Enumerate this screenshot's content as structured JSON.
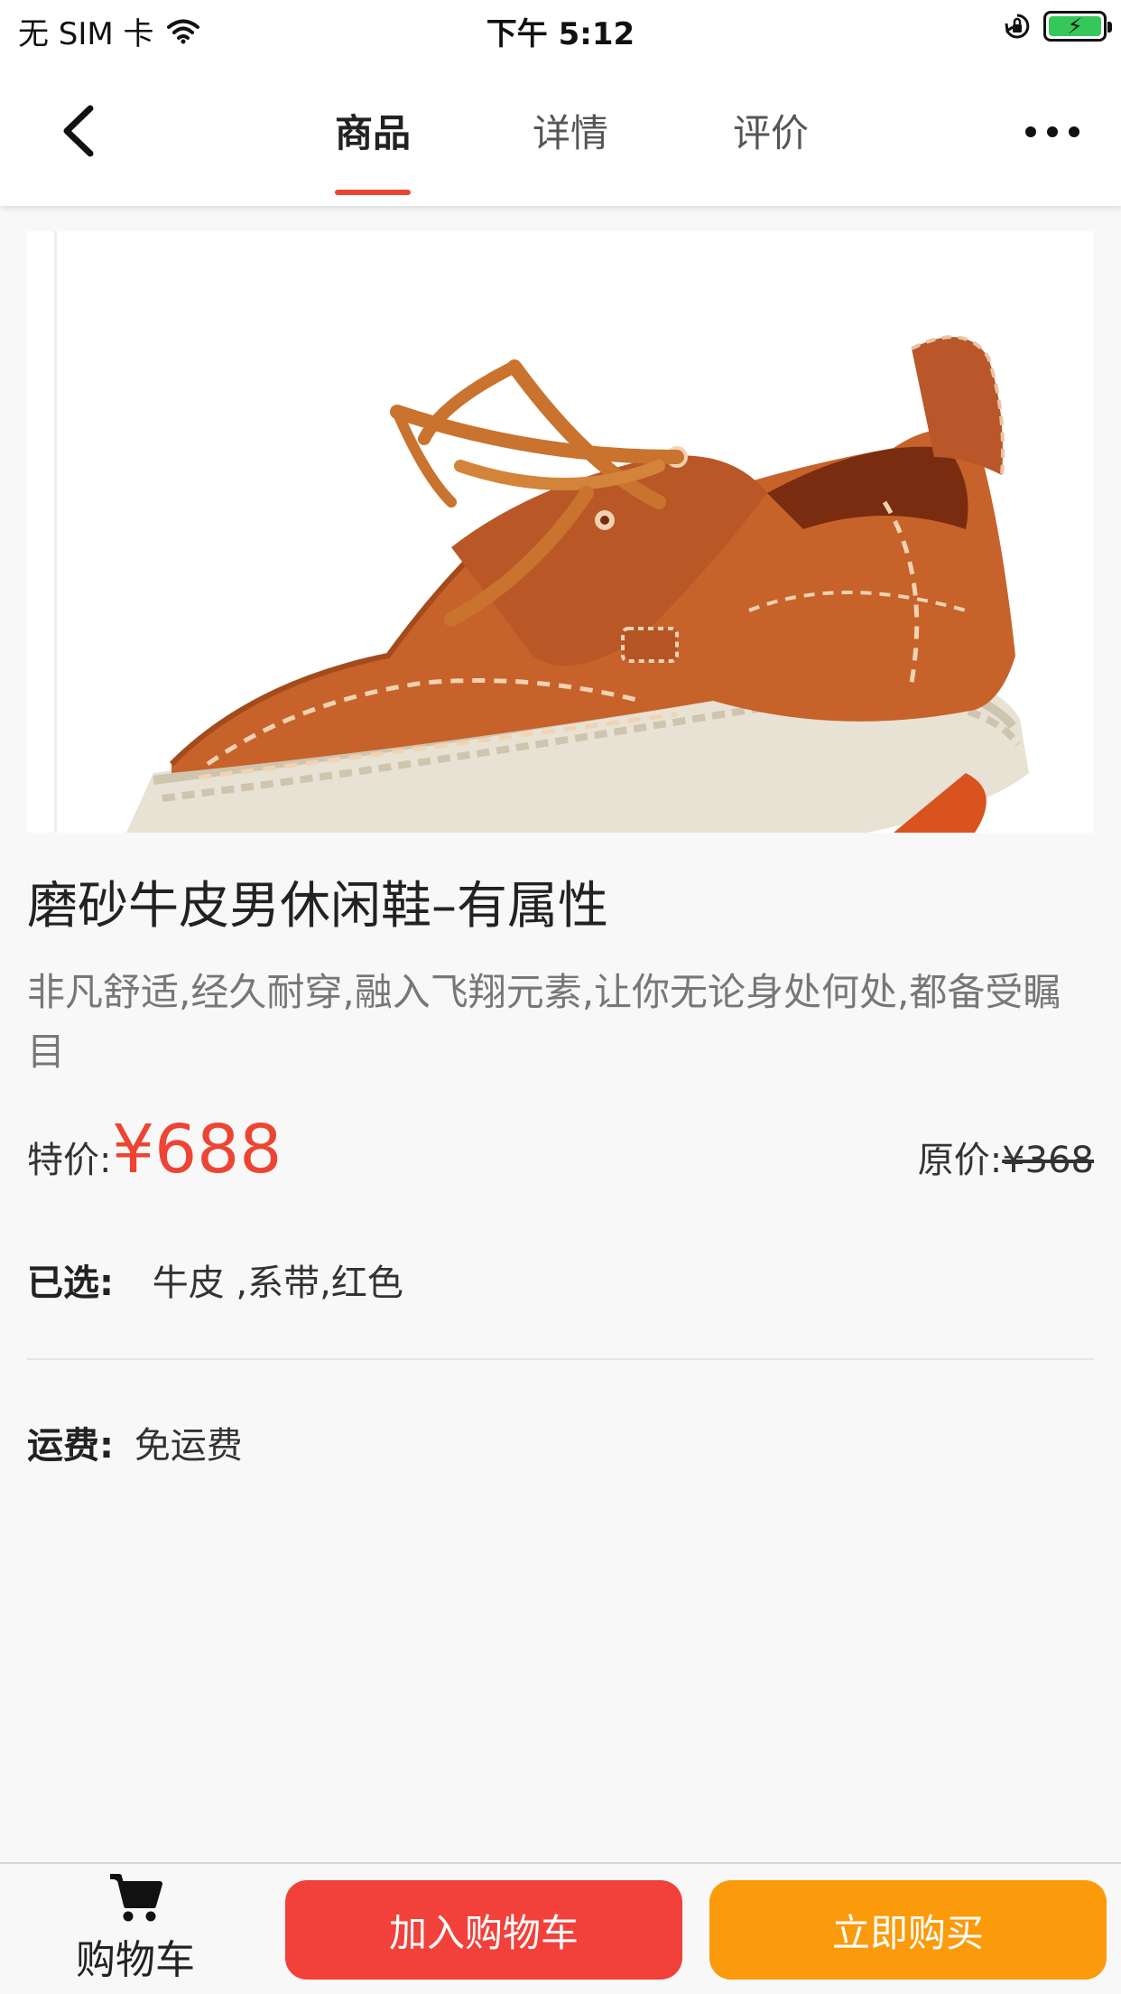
{
  "status_bar": {
    "carrier": "无 SIM 卡",
    "time": "下午 5:12"
  },
  "nav": {
    "tabs": [
      {
        "label": "商品",
        "active": true
      },
      {
        "label": "详情",
        "active": false
      },
      {
        "label": "评价",
        "active": false
      }
    ]
  },
  "product": {
    "title": "磨砂牛皮男休闲鞋–有属性",
    "description": "非凡舒适,经久耐穿,融入飞翔元素,让你无论身处何处,都备受瞩目",
    "price_label": "特价:",
    "price": "¥688",
    "original_price_label": "原价:",
    "original_price": "¥368"
  },
  "selected": {
    "label": "已选:",
    "value": "牛皮 ,系带,红色"
  },
  "shipping": {
    "label": "运费:",
    "value": "免运费"
  },
  "bottom_bar": {
    "cart_label": "购物车",
    "add_to_cart": "加入购物车",
    "buy_now": "立即购买"
  },
  "colors": {
    "accent_red": "#ee4433",
    "add_button": "#f2403a",
    "buy_button": "#fb9a0a"
  }
}
